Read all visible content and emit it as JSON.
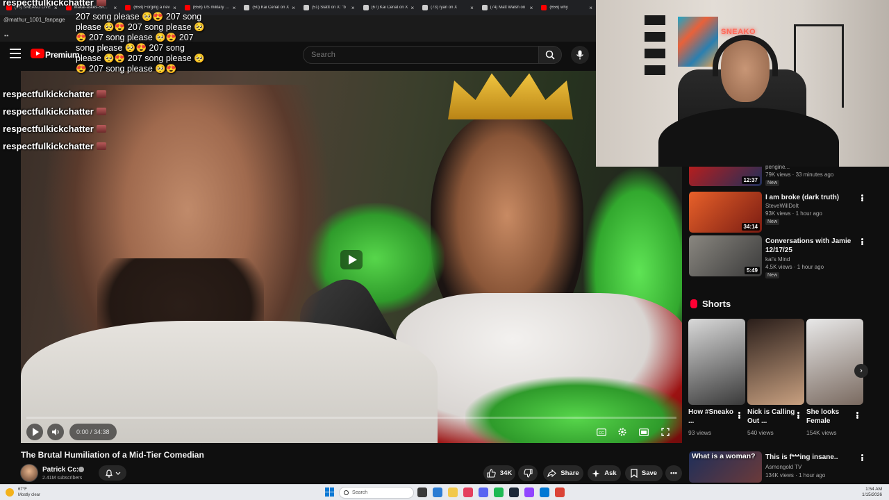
{
  "browser": {
    "tabs": [
      {
        "label": "(95) SNEAKO LIVE",
        "color": "#ff0000"
      },
      {
        "label": "Makai-askes-Sn...",
        "color": "#ff0000"
      },
      {
        "label": "(658) Forging a nev",
        "color": "#ff0000"
      },
      {
        "label": "(658) US military po",
        "color": "#ff0000"
      },
      {
        "label": "(50) Kai Cenat on X",
        "color": "#cccccc"
      },
      {
        "label": "(51) Slattt on X: \"b",
        "color": "#cccccc"
      },
      {
        "label": "(67) Kai Cenat on X",
        "color": "#cccccc"
      },
      {
        "label": "(73) ryan on X",
        "color": "#cccccc"
      },
      {
        "label": "(74) Matt Walsh on",
        "color": "#cccccc"
      },
      {
        "label": "(656) why",
        "color": "#ff0000"
      }
    ],
    "channel_tag": "@mathur_1001_fanpage"
  },
  "chat": {
    "top_user": "respectfulkickchatter",
    "spam_message": "207 song please 🥺😍 207 song please 🥺😍 207 song please 🥺😍 207 song please 🥺😍 207 song please 🥺😍 207 song please 🥺😍 207 song please 🥺😍 207 song please 🥺😍",
    "lines": [
      "respectfulkickchatter",
      "respectfulkickchatter",
      "respectfulkickchatter",
      "respectfulkickchatter"
    ]
  },
  "youtube": {
    "brand": "Premium",
    "search_placeholder": "Search"
  },
  "player": {
    "time": "0:00 / 34:38",
    "progress": 0.0
  },
  "video": {
    "title": "The Brutal Humiliation of a Mid-Tier Comedian",
    "channel": "Patrick Cc:",
    "subscribers": "2.41M subscribers",
    "likes": "34K",
    "share_label": "Share",
    "ask_label": "Ask",
    "save_label": "Save"
  },
  "webcam": {
    "sign_text": "SNEAKO"
  },
  "recommendations": [
    {
      "title": "",
      "channel": "pengine...",
      "meta": "79K views · 33 minutes ago",
      "badge": "New",
      "duration": "12:37",
      "thumb_colors": [
        "#b51e1e",
        "#1f2f5a"
      ]
    },
    {
      "title": "I am broke (dark truth)",
      "channel": "SteveWillDoIt",
      "meta": "93K views · 1 hour ago",
      "badge": "New",
      "duration": "34:14",
      "thumb_colors": [
        "#e8612a",
        "#7a1c12"
      ]
    },
    {
      "title": "Conversations with Jamie 12/17/25",
      "channel": "kai's Mind",
      "meta": "4.5K views · 1 hour ago",
      "badge": "New",
      "duration": "5:49",
      "thumb_colors": [
        "#8a8780",
        "#3a3a3a"
      ]
    }
  ],
  "shorts": {
    "label": "Shorts",
    "items": [
      {
        "title": "How #Sneako ...",
        "views": "93 views",
        "colors": [
          "#d9d9d9",
          "#3a3a3a"
        ]
      },
      {
        "title": "Nick is Calling Out ...",
        "views": "540 views",
        "colors": [
          "#2a1e1a",
          "#c8a080"
        ]
      },
      {
        "title": "She looks Female",
        "views": "154K views",
        "colors": [
          "#e8e8e8",
          "#7a6a60"
        ]
      }
    ]
  },
  "bottom_recs": [
    {
      "title": "What is a woman?"
    },
    {
      "title": "This is f***ing insane..",
      "channel": "Asmongold TV",
      "meta": "134K views · 1 hour ago"
    }
  ],
  "taskbar": {
    "weather_temp": "67°F",
    "weather_desc": "Mostly clear",
    "search_label": "Search",
    "time": "1:54 AM",
    "date": "1/15/2026"
  }
}
